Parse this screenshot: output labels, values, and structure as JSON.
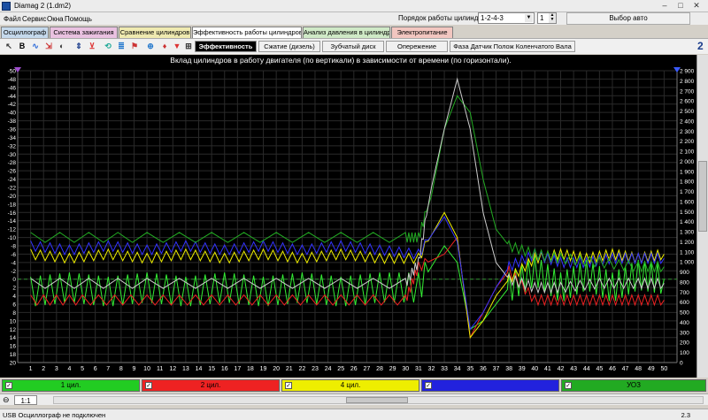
{
  "window": {
    "title": "Diamag 2 (1.dm2)"
  },
  "menu": [
    "Файл",
    "Сервис",
    "Окна",
    "Помощь"
  ],
  "cylinder_order": {
    "label": "Порядок работы цилиндров",
    "value": "1-2-4-3",
    "spin_value": "1"
  },
  "select_car_label": "Выбор авто",
  "tabs": [
    {
      "label": "Осциллограф",
      "color": "#c5d9ec"
    },
    {
      "label": "Система зажигания",
      "color": "#e9c1e0"
    },
    {
      "label": "Сравнение цилиндров",
      "color": "#efeab0"
    },
    {
      "label": "Эффективность работы цилиндров",
      "color": "#ffffff"
    },
    {
      "label": "Анализ давления в цилиндре",
      "color": "#cfe9c6"
    },
    {
      "label": "Электропитание",
      "color": "#f2c6c0"
    }
  ],
  "toolbar_icons": [
    "cursor-icon",
    "bold-b-icon",
    "sine-icon",
    "fit-icon",
    "contrast-icon",
    "scale-icon",
    "filter-icon",
    "reset-icon",
    "stack-icon",
    "tree-icon",
    "zoom-icon",
    "marker-icon",
    "funnel-icon",
    "grid-icon"
  ],
  "subtabs": [
    "Эффективность",
    "Сжатие (дизель)",
    "Зубчатый диск",
    "Опережение",
    "Фаза Датчик Полож Коленчатого Вала"
  ],
  "side_number": "2",
  "legend": [
    {
      "label": "1 цил.",
      "color": "#22cc22"
    },
    {
      "label": "2 цил.",
      "color": "#ee2222"
    },
    {
      "label": "4 цил.",
      "color": "#eeee00"
    },
    {
      "label": "",
      "color": "#2222dd"
    },
    {
      "label": "УОЗ",
      "color": "#22aa22"
    }
  ],
  "scale_value": "1:1",
  "status": {
    "text": "USB Осциллограф не подключен",
    "version": "2.3"
  },
  "chart_data": {
    "type": "line",
    "title": "Вклад цилиндров в работу двигателя (по вертикали) в зависимости от времени (по горизонтали).",
    "x_ticks": [
      1,
      2,
      3,
      4,
      5,
      6,
      7,
      8,
      9,
      10,
      11,
      12,
      13,
      14,
      15,
      16,
      17,
      18,
      19,
      20,
      21,
      22,
      23,
      24,
      25,
      26,
      27,
      28,
      29,
      30,
      31,
      32,
      33,
      34,
      35,
      36,
      37,
      38,
      39,
      40,
      41,
      42,
      43,
      44,
      45,
      46,
      47,
      48,
      49,
      50
    ],
    "xlim": [
      0,
      51
    ],
    "y_left_ticks": [
      "-50",
      "-48",
      "-46",
      "-44",
      "-42",
      "-40",
      "-38",
      "-36",
      "-34",
      "-32",
      "-30",
      "-28",
      "-26",
      "-24",
      "-22",
      "-20",
      "-18",
      "-16",
      "-14",
      "-12",
      "-10",
      "-8",
      "-6",
      "-4",
      "-2",
      "0",
      "2",
      "4",
      "6",
      "8",
      "10",
      "12",
      "14",
      "16",
      "18",
      "20"
    ],
    "ylim_left": [
      -50,
      20
    ],
    "y_right_ticks": [
      "2 900",
      "2 800",
      "2 700",
      "2 600",
      "2 500",
      "2 400",
      "2 300",
      "2 200",
      "2 100",
      "2 000",
      "1 900",
      "1 800",
      "1 700",
      "1 600",
      "1 500",
      "1 400",
      "1 300",
      "1 200",
      "1 100",
      "1 000",
      "900",
      "800",
      "700",
      "600",
      "500",
      "400",
      "300",
      "200",
      "100",
      "0"
    ],
    "ylim_right": [
      0,
      2900
    ],
    "grid": true,
    "series": [
      {
        "name": "1 цил.",
        "color": "#33ee33",
        "x": [
          1,
          4,
          7,
          10,
          13,
          16,
          19,
          22,
          25,
          28,
          31,
          33,
          34,
          35,
          36,
          37,
          38,
          40,
          42,
          44,
          46,
          48,
          50
        ],
        "y": [
          3,
          2,
          3,
          2,
          3,
          2,
          3,
          2,
          3,
          2,
          2,
          -8,
          -4,
          12,
          10,
          6,
          2,
          -2,
          2,
          -1,
          2,
          -1,
          0
        ]
      },
      {
        "name": "2 цил.",
        "color": "#ee2222",
        "x": [
          1,
          5,
          10,
          15,
          20,
          25,
          30,
          31,
          33,
          34,
          35,
          36,
          37,
          38,
          40,
          42,
          44,
          46,
          48,
          50
        ],
        "y": [
          5,
          5,
          5,
          5,
          5,
          5,
          5,
          -3,
          -6,
          -10,
          14,
          8,
          2,
          -2,
          5,
          5,
          5,
          5,
          5,
          5
        ]
      },
      {
        "name": "4 цил.",
        "color": "#eeee00",
        "x": [
          1,
          4,
          7,
          10,
          13,
          16,
          19,
          22,
          25,
          28,
          31,
          33,
          34,
          35,
          36,
          37,
          38,
          40,
          42,
          44,
          46,
          48,
          50
        ],
        "y": [
          -6,
          -5,
          -6,
          -5,
          -6,
          -5,
          -6,
          -5,
          -6,
          -5,
          -5,
          -16,
          -10,
          14,
          10,
          4,
          0,
          -5,
          -6,
          -5,
          -6,
          -5,
          -6
        ]
      },
      {
        "name": "",
        "color": "#3333ff",
        "x": [
          1,
          4,
          7,
          10,
          13,
          16,
          19,
          22,
          25,
          28,
          31,
          33,
          34,
          35,
          36,
          37,
          38,
          40,
          42,
          44,
          46,
          48,
          50
        ],
        "y": [
          -8,
          -7,
          -8,
          -7,
          -8,
          -7,
          -8,
          -7,
          -8,
          -7,
          -6,
          -15,
          -9,
          12,
          8,
          2,
          -3,
          -6,
          -4,
          -4,
          -5,
          -5,
          -5
        ]
      },
      {
        "name": "УОЗ",
        "color": "#22aa22",
        "x": [
          1,
          10,
          20,
          30,
          31,
          32,
          33,
          34,
          35,
          36,
          37,
          38,
          40,
          42,
          45,
          48,
          50
        ],
        "y": [
          -10,
          -10,
          -10,
          -10,
          -10,
          -20,
          -36,
          -44,
          -40,
          -24,
          -12,
          -8,
          -6,
          -5,
          -4,
          -3,
          -3
        ]
      },
      {
        "name": "",
        "color": "#cccccc",
        "x": [
          1,
          10,
          20,
          30,
          31,
          32,
          33,
          34,
          35,
          36,
          37,
          38,
          40,
          42,
          45,
          48,
          50
        ],
        "y": [
          1,
          1,
          1,
          1,
          -4,
          -22,
          -36,
          -48,
          -36,
          -16,
          -4,
          0,
          2,
          2,
          1,
          1,
          1
        ]
      }
    ]
  }
}
